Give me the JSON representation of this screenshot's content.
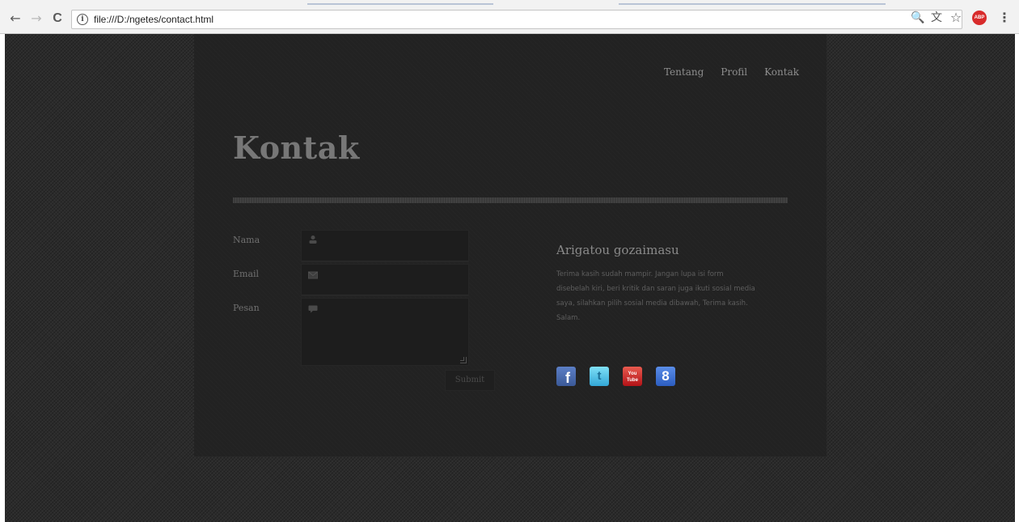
{
  "browser": {
    "back_icon": "←",
    "forward_icon": "→",
    "reload_icon": "C",
    "info_icon": "i",
    "url": "file:///D:/ngetes/contact.html",
    "zoom_icon": "🔍",
    "translate_icon": "文",
    "star_icon": "☆",
    "abp_label": "ABP",
    "menu_icon": "⋮"
  },
  "nav": {
    "items": [
      "Tentang",
      "Profil",
      "Kontak"
    ]
  },
  "page": {
    "title": "Kontak"
  },
  "form": {
    "name_label": "Nama",
    "email_label": "Email",
    "message_label": "Pesan",
    "submit_label": "Submit",
    "name_value": "",
    "email_value": "",
    "message_value": ""
  },
  "side": {
    "title": "Arigatou gozaimasu",
    "text": "Terima kasih sudah mampir. Jangan lupa isi form disebelah kiri, beri kritik dan saran juga ikuti sosial media saya, silahkan pilih sosial media dibawah, Terima kasih. Salam."
  },
  "social": {
    "facebook": "f",
    "twitter": "t",
    "youtube": "You Tube",
    "google": "8"
  }
}
